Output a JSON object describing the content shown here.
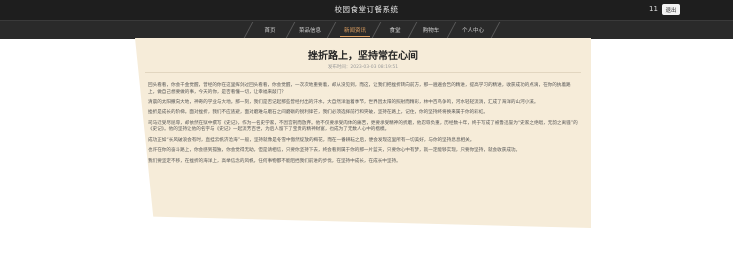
{
  "header": {
    "app_title": "校园食堂订餐系统",
    "user_count": "11",
    "logout_label": "退出"
  },
  "nav": {
    "items": [
      {
        "label": "首页"
      },
      {
        "label": "菜品信息"
      },
      {
        "label": "新闻资讯",
        "active": true
      },
      {
        "label": "食堂"
      },
      {
        "label": "购物车"
      },
      {
        "label": "个人中心"
      }
    ],
    "accent_color": "#e0a060"
  },
  "article": {
    "title": "挫折路上，坚持常在心间",
    "meta": "发布时间：2023-03-03 08:19:51",
    "paragraphs": [
      "回头看看，你会千金觉醒，曾经的你在这里挥剑过回头看看，你会觉醒，一次次地重要着，却从没见到，而这，让我们把挫折转向前方，那一遍遍会告的精进，提高学习的精进，收获成功的点滴，在你的执着路上，做自己想要做的事，今天的你，是否看懂一切，让幸福来敲门？",
      "清晨的太阳撒向大地，神奇的学业与大地。那一刻，我们是否记起那些曾经付出的汗水，大自然洋溢着季节，世界因太阳的照射而精彩，林中百鸟争鸣，河水轻轻流淌，汇成了海洋的山河小溪。",
      "挫折是成长的阶梯。面对挫折，我们不应逃避，面对磨难与磨石之间磨砺的锐利锋芒，我们必须选择前行和突破，坚持在路上，记住，你的坚持终将换来属于你的彩虹。",
      "司马迁受尽屈辱，却依然在狱中撰写《史记》，作为一名史学家，不因宫刑而放弃。他不仅要承受肉体的痛苦，更要承受精神的折磨，他忍辱负重，历经数十年，终于写成了被鲁迅誉为“史家之绝唱，无韵之离骚”的《史记》。他的坚持让他的名字与《史记》一起流芳百世，为后人留下了宝贵的精神财富，也成为了无数人心中的楷模。",
      "成功正如“长风破浪会有时，直挂云帆济沧海”一般，坚持就像是冬雪中傲然绽放的梅花，而在一番耕耘之后，便会发现这里所有一切美好，与你的坚持息息相关。",
      "也许在你的奋斗路上，你会感到孤独，你会觉得无助，但是请相信，只要你坚持下去，终会看到属于你的那一片蓝天，只要你心中有梦，就一定能够实现，只要你坚持，就会收获成功。",
      "我们要坚定不移，在挫折的海洋上，高举信念的风帆，任何事物都不能阻挡我们前进的步伐，在坚持中成长，在成长中坚持。"
    ]
  }
}
